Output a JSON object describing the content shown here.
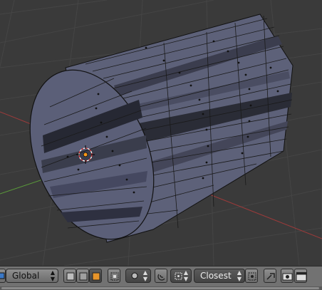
{
  "viewport": {
    "object": "cylinder-mesh",
    "colors": {
      "background": "#3a3a3a",
      "grid": "#454545",
      "x_axis": "#9c3a3a",
      "y_axis": "#5a9a3a",
      "mesh": "#5b5f7a",
      "edges": "#111111"
    }
  },
  "header": {
    "orientation": {
      "value": "Global"
    },
    "snap_target": {
      "value": "Closest"
    }
  }
}
